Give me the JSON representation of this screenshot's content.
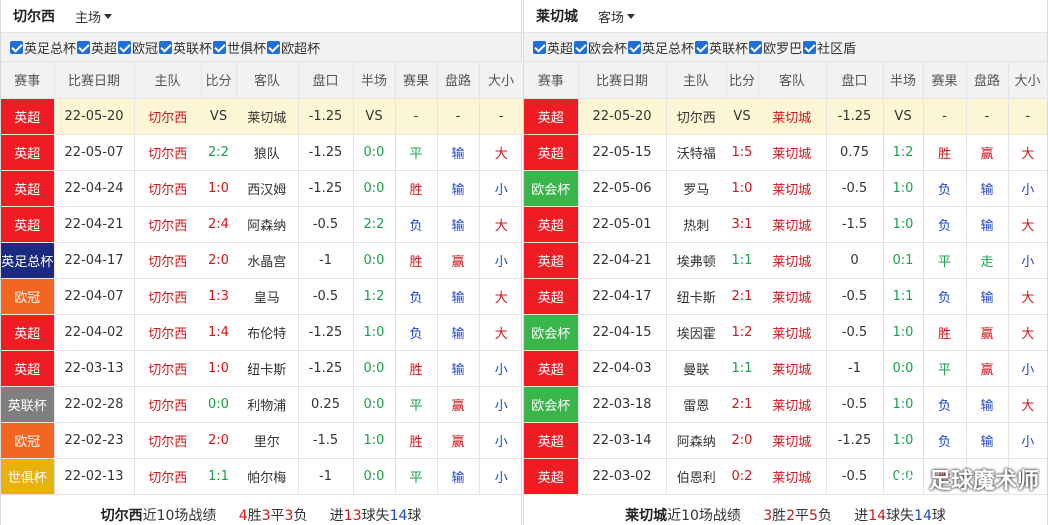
{
  "colors": {
    "league": {
      "英超": "#ef1c24",
      "英足总杯": "#1a2a80",
      "欧冠": "#f26522",
      "英联杯": "#7f7f7f",
      "世俱杯": "#e8b20c",
      "欧会杯": "#39b54a"
    },
    "result": {
      "胜": "red",
      "平": "green",
      "负": "blue"
    },
    "pan": {
      "赢": "red",
      "走": "green",
      "输": "blue"
    },
    "size": {
      "大": "red",
      "小": "blue"
    }
  },
  "columns": [
    "赛事",
    "比赛日期",
    "主队",
    "比分",
    "客队",
    "盘口",
    "半场",
    "赛果",
    "盘路",
    "大小"
  ],
  "left": {
    "team": "切尔西",
    "venue": "主场",
    "filters": [
      "英足总杯",
      "英超",
      "欧冠",
      "英联杯",
      "世俱杯",
      "欧超杯"
    ],
    "rows": [
      {
        "league": "英超",
        "date": "22-05-20",
        "home": "切尔西",
        "score": "VS",
        "away": "莱切城",
        "handicap": "-1.25",
        "half": "VS",
        "result": "-",
        "pan": "-",
        "size": "-"
      },
      {
        "league": "英超",
        "date": "22-05-07",
        "home": "切尔西",
        "score": "2:2",
        "away": "狼队",
        "handicap": "-1.25",
        "half": "0:0",
        "result": "平",
        "pan": "输",
        "size": "大"
      },
      {
        "league": "英超",
        "date": "22-04-24",
        "home": "切尔西",
        "score": "1:0",
        "away": "西汉姆",
        "handicap": "-1.25",
        "half": "0:0",
        "result": "胜",
        "pan": "输",
        "size": "小"
      },
      {
        "league": "英超",
        "date": "22-04-21",
        "home": "切尔西",
        "score": "2:4",
        "away": "阿森纳",
        "handicap": "-0.5",
        "half": "2:2",
        "result": "负",
        "pan": "输",
        "size": "大"
      },
      {
        "league": "英足总杯",
        "date": "22-04-17",
        "home": "切尔西",
        "score": "2:0",
        "away": "水晶宫",
        "handicap": "-1",
        "half": "0:0",
        "result": "胜",
        "pan": "赢",
        "size": "小"
      },
      {
        "league": "欧冠",
        "date": "22-04-07",
        "home": "切尔西",
        "score": "1:3",
        "away": "皇马",
        "handicap": "-0.5",
        "half": "1:2",
        "result": "负",
        "pan": "输",
        "size": "大"
      },
      {
        "league": "英超",
        "date": "22-04-02",
        "home": "切尔西",
        "score": "1:4",
        "away": "布伦特",
        "handicap": "-1.25",
        "half": "1:0",
        "result": "负",
        "pan": "输",
        "size": "大"
      },
      {
        "league": "英超",
        "date": "22-03-13",
        "home": "切尔西",
        "score": "1:0",
        "away": "纽卡斯",
        "handicap": "-1.25",
        "half": "0:0",
        "result": "胜",
        "pan": "输",
        "size": "小"
      },
      {
        "league": "英联杯",
        "date": "22-02-28",
        "home": "切尔西",
        "score": "0:0",
        "away": "利物浦",
        "handicap": "0.25",
        "half": "0:0",
        "result": "平",
        "pan": "赢",
        "size": "小"
      },
      {
        "league": "欧冠",
        "date": "22-02-23",
        "home": "切尔西",
        "score": "2:0",
        "away": "里尔",
        "handicap": "-1.5",
        "half": "1:0",
        "result": "胜",
        "pan": "赢",
        "size": "小"
      },
      {
        "league": "世俱杯",
        "date": "22-02-13",
        "home": "切尔西",
        "score": "1:1",
        "away": "帕尔梅",
        "handicap": "-1",
        "half": "0:0",
        "result": "平",
        "pan": "输",
        "size": "小"
      }
    ],
    "summary": {
      "team": "切尔西",
      "label": "近10场战绩",
      "w": "4",
      "d": "3",
      "l": "3",
      "gf": "13",
      "ga": "14"
    }
  },
  "right": {
    "team": "莱切城",
    "venue": "客场",
    "filters": [
      "英超",
      "欧会杯",
      "英足总杯",
      "英联杯",
      "欧罗巴",
      "社区盾"
    ],
    "rows": [
      {
        "league": "英超",
        "date": "22-05-20",
        "home": "切尔西",
        "score": "VS",
        "away": "莱切城",
        "handicap": "-1.25",
        "half": "VS",
        "result": "-",
        "pan": "-",
        "size": "-"
      },
      {
        "league": "英超",
        "date": "22-05-15",
        "home": "沃特福",
        "score": "1:5",
        "away": "莱切城",
        "handicap": "0.75",
        "half": "1:2",
        "result": "胜",
        "pan": "赢",
        "size": "大"
      },
      {
        "league": "欧会杯",
        "date": "22-05-06",
        "home": "罗马",
        "score": "1:0",
        "away": "莱切城",
        "handicap": "-0.5",
        "half": "1:0",
        "result": "负",
        "pan": "输",
        "size": "小"
      },
      {
        "league": "英超",
        "date": "22-05-01",
        "home": "热刺",
        "score": "3:1",
        "away": "莱切城",
        "handicap": "-1.5",
        "half": "1:0",
        "result": "负",
        "pan": "输",
        "size": "大"
      },
      {
        "league": "英超",
        "date": "22-04-21",
        "home": "埃弗顿",
        "score": "1:1",
        "away": "莱切城",
        "handicap": "0",
        "half": "0:1",
        "result": "平",
        "pan": "走",
        "size": "小"
      },
      {
        "league": "英超",
        "date": "22-04-17",
        "home": "纽卡斯",
        "score": "2:1",
        "away": "莱切城",
        "handicap": "-0.5",
        "half": "1:1",
        "result": "负",
        "pan": "输",
        "size": "大"
      },
      {
        "league": "欧会杯",
        "date": "22-04-15",
        "home": "埃因霍",
        "score": "1:2",
        "away": "莱切城",
        "handicap": "-0.5",
        "half": "1:0",
        "result": "胜",
        "pan": "赢",
        "size": "大"
      },
      {
        "league": "英超",
        "date": "22-04-03",
        "home": "曼联",
        "score": "1:1",
        "away": "莱切城",
        "handicap": "-1",
        "half": "0:0",
        "result": "平",
        "pan": "赢",
        "size": "小"
      },
      {
        "league": "欧会杯",
        "date": "22-03-18",
        "home": "雷恩",
        "score": "2:1",
        "away": "莱切城",
        "handicap": "-0.5",
        "half": "1:0",
        "result": "负",
        "pan": "输",
        "size": "大"
      },
      {
        "league": "英超",
        "date": "22-03-14",
        "home": "阿森纳",
        "score": "2:0",
        "away": "莱切城",
        "handicap": "-1.25",
        "half": "1:0",
        "result": "负",
        "pan": "输",
        "size": "小"
      },
      {
        "league": "英超",
        "date": "22-03-02",
        "home": "伯恩利",
        "score": "0:2",
        "away": "莱切城",
        "handicap": "-0.5",
        "half": "0:0",
        "result": "胜",
        "pan": "赢",
        "size": "小"
      }
    ],
    "summary": {
      "team": "莱切城",
      "label": "近10场战绩",
      "w": "3",
      "d": "2",
      "l": "5",
      "gf": "14",
      "ga": "14"
    }
  },
  "watermark": "足球魔术师"
}
